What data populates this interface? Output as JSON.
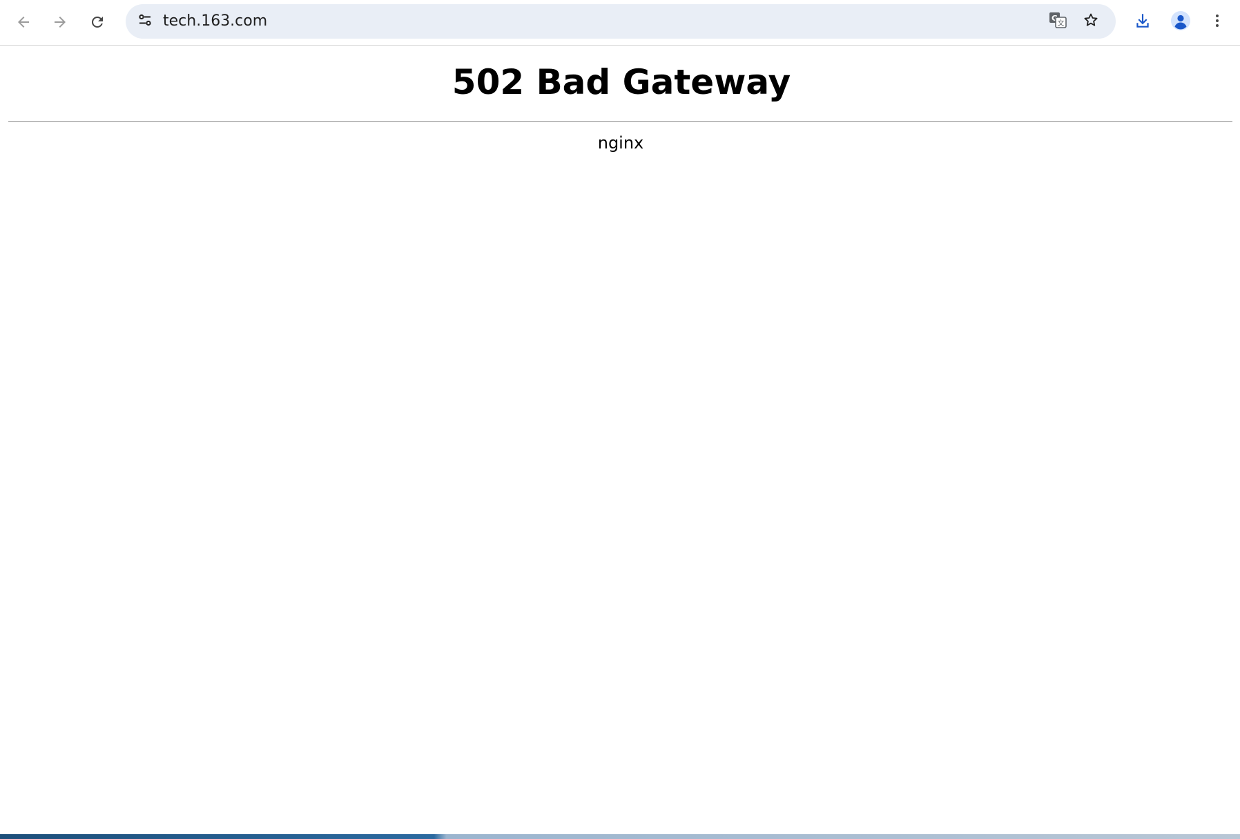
{
  "browser": {
    "url": "tech.163.com",
    "icons": {
      "back": "arrow-left-icon",
      "forward": "arrow-right-icon",
      "reload": "reload-icon",
      "site_info": "tune-icon",
      "translate": "translate-icon",
      "bookmark": "star-icon",
      "downloads": "download-icon",
      "profile": "person-icon",
      "menu": "kebab-menu-icon"
    },
    "colors": {
      "omnibox_bg": "#e9eef6",
      "accent": "#1a57c9",
      "icon": "#474747",
      "disabled_icon": "#9b9b9b"
    }
  },
  "page": {
    "title": "502 Bad Gateway",
    "server": "nginx"
  }
}
